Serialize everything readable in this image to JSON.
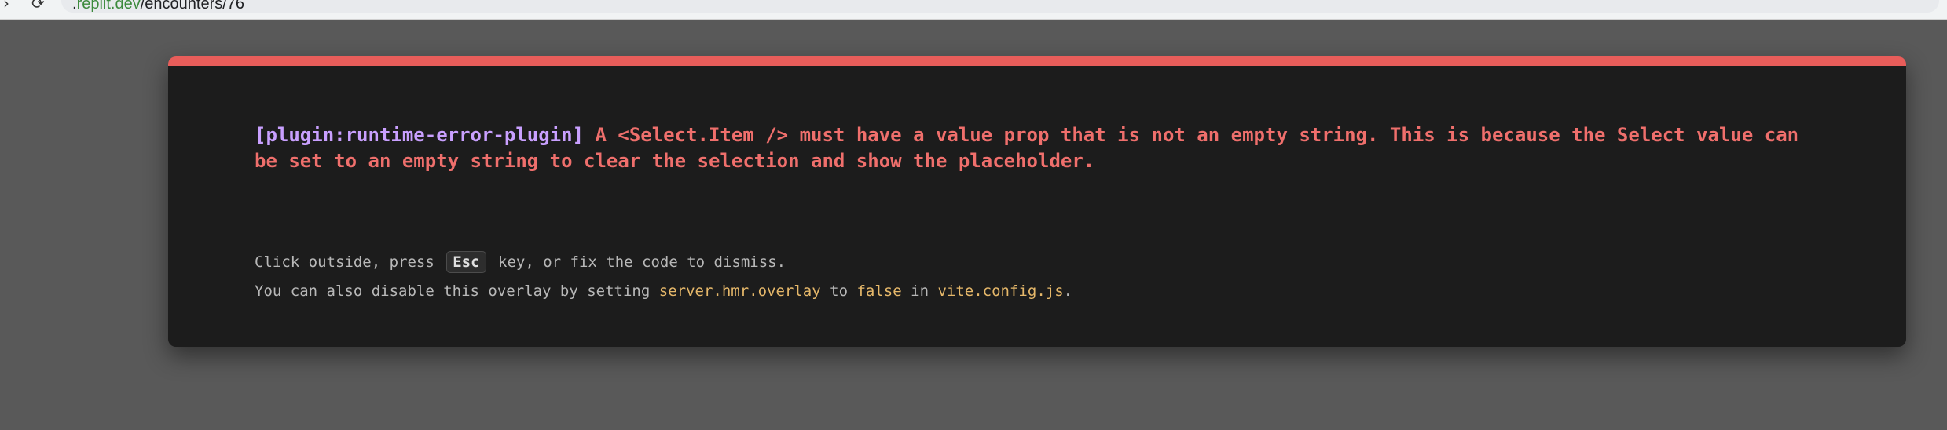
{
  "browser": {
    "url_prefix": ".",
    "url_host": "replit.dev",
    "url_path": "/encounters/76"
  },
  "overlay": {
    "plugin": "[plugin:runtime-error-plugin]",
    "message": "A <Select.Item /> must have a value prop that is not an empty string. This is because the Select value can be set to an empty string to clear the selection and show the placeholder.",
    "tip1_before": "Click outside, press",
    "tip1_key": "Esc",
    "tip1_after": "key, or fix the code to dismiss.",
    "tip2_a": "You can also disable this overlay by setting",
    "tip2_code1": "server.hmr.overlay",
    "tip2_b": "to",
    "tip2_code2": "false",
    "tip2_c": "in",
    "tip2_code3": "vite.config.js",
    "tip2_end": "."
  },
  "colors": {
    "accent": "#e85d5a",
    "plugin": "#c9a0ff",
    "code": "#e6b86a"
  }
}
